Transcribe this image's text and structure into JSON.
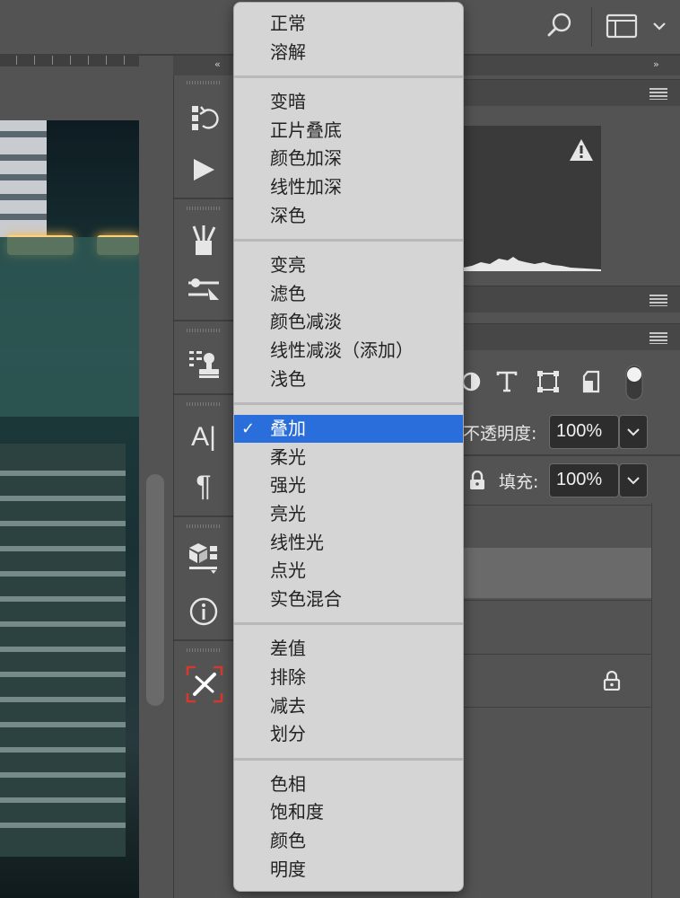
{
  "topbar": {
    "search_icon": "search-icon",
    "workspace_icon": "workspace-layout-icon",
    "chevron_icon": "chevron-down-icon"
  },
  "toolstrip": {
    "collapse_label": "‹‹",
    "tools": [
      {
        "name": "history-brush-icon"
      },
      {
        "name": "play-icon"
      },
      {
        "name": "brushes-icon"
      },
      {
        "name": "adjust-sliders-icon"
      },
      {
        "name": "clone-stamp-icon"
      },
      {
        "name": "character-icon",
        "glyph": "A|"
      },
      {
        "name": "paragraph-icon",
        "glyph": "¶"
      },
      {
        "name": "3d-icon"
      },
      {
        "name": "info-icon",
        "glyph": "i"
      },
      {
        "name": "plugin-x-icon"
      }
    ]
  },
  "right_panel": {
    "expand_label": "››",
    "opacity_label": "不透明度:",
    "opacity_value": "100%",
    "fill_label": "填充:",
    "fill_value": "100%",
    "warning_icon": "warning-icon",
    "lock_icon": "lock-icon"
  },
  "menu": {
    "groups": [
      {
        "items": [
          "正常",
          "溶解"
        ]
      },
      {
        "items": [
          "变暗",
          "正片叠底",
          "颜色加深",
          "线性加深",
          "深色"
        ]
      },
      {
        "items": [
          "变亮",
          "滤色",
          "颜色减淡",
          "线性减淡（添加）",
          "浅色"
        ]
      },
      {
        "items": [
          "叠加",
          "柔光",
          "强光",
          "亮光",
          "线性光",
          "点光",
          "实色混合"
        ]
      },
      {
        "items": [
          "差值",
          "排除",
          "减去",
          "划分"
        ]
      },
      {
        "items": [
          "色相",
          "饱和度",
          "颜色",
          "明度"
        ]
      }
    ],
    "selected": "叠加",
    "check_mark": "✓"
  },
  "colors": {
    "menu_bg": "#d5d5d5",
    "selected_bg": "#2a6edc",
    "panel_bg": "#535353",
    "accent_red": "#d13b2b"
  }
}
